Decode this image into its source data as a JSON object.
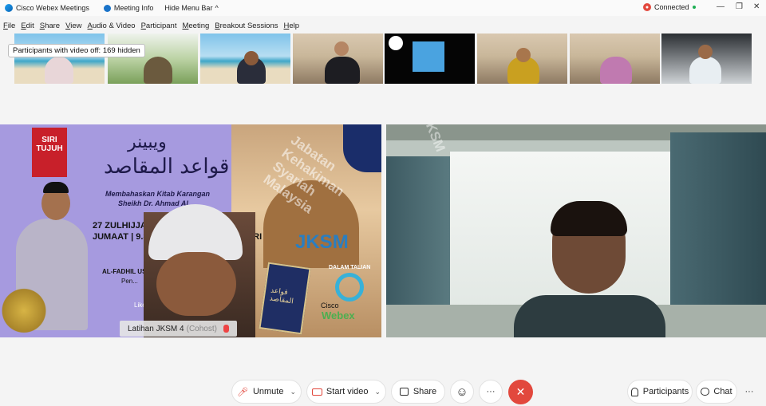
{
  "titlebar": {
    "app_title": "Cisco Webex Meetings",
    "meeting_info": "Meeting Info",
    "hide_menu_bar": "Hide Menu Bar",
    "hide_menu_caret": "^",
    "connection_status": "Connected",
    "minimize": "—",
    "restore": "❐",
    "close": "✕"
  },
  "menubar": {
    "items": [
      {
        "hot": "F",
        "rest": "ile"
      },
      {
        "hot": "E",
        "rest": "dit"
      },
      {
        "hot": "S",
        "rest": "hare"
      },
      {
        "hot": "V",
        "rest": "iew"
      },
      {
        "hot": "A",
        "rest": "udio & Video"
      },
      {
        "hot": "P",
        "rest": "articipant"
      },
      {
        "hot": "M",
        "rest": "eeting"
      },
      {
        "hot": "B",
        "rest": "reakout Sessions"
      },
      {
        "hot": "H",
        "rest": "elp"
      }
    ]
  },
  "participant_strip": {
    "tooltip": "Participants with video off: 169 hidden"
  },
  "main_video": {
    "left": {
      "siri": "SIRI",
      "tujuh": "TUJUH",
      "arabic_title": "ويبينر",
      "arabic_subtitle": "قواعد المقاصد",
      "italic_line1": "Membahaskan Kitab Karangan",
      "italic_line2": "Sheikh Dr. Ahmad Al...",
      "date_line1": "27 ZULHIJJAH 14...",
      "date_line2": "JUMAAT | 9.30 P...",
      "date_line3": "...RI",
      "speaker_line1": "AL-FADHIL UST...",
      "speaker_line2": "Pen...",
      "jksm": "JKSM",
      "dalam": "DALAM TALIAN",
      "cisco": "Cisco",
      "webex": "Webex",
      "like": "Like...",
      "book_title": "قواعد المقاصد",
      "watermark_1": "Jabatan Kehakiman Syariah Malaysia",
      "watermark_2": "JKSM",
      "name_label": "Latihan JKSM 4",
      "cohost": "(Cohost)"
    }
  },
  "controls": {
    "unmute": "Unmute",
    "start_video": "Start video",
    "share": "Share",
    "participants": "Participants",
    "chat": "Chat",
    "more": "···",
    "end_icon": "✕",
    "caret": "⌄",
    "reactions": "☺"
  },
  "colors": {
    "end_red": "#e2483d",
    "connected_green": "#1dae53",
    "video_off_icon": "#e2483d"
  }
}
